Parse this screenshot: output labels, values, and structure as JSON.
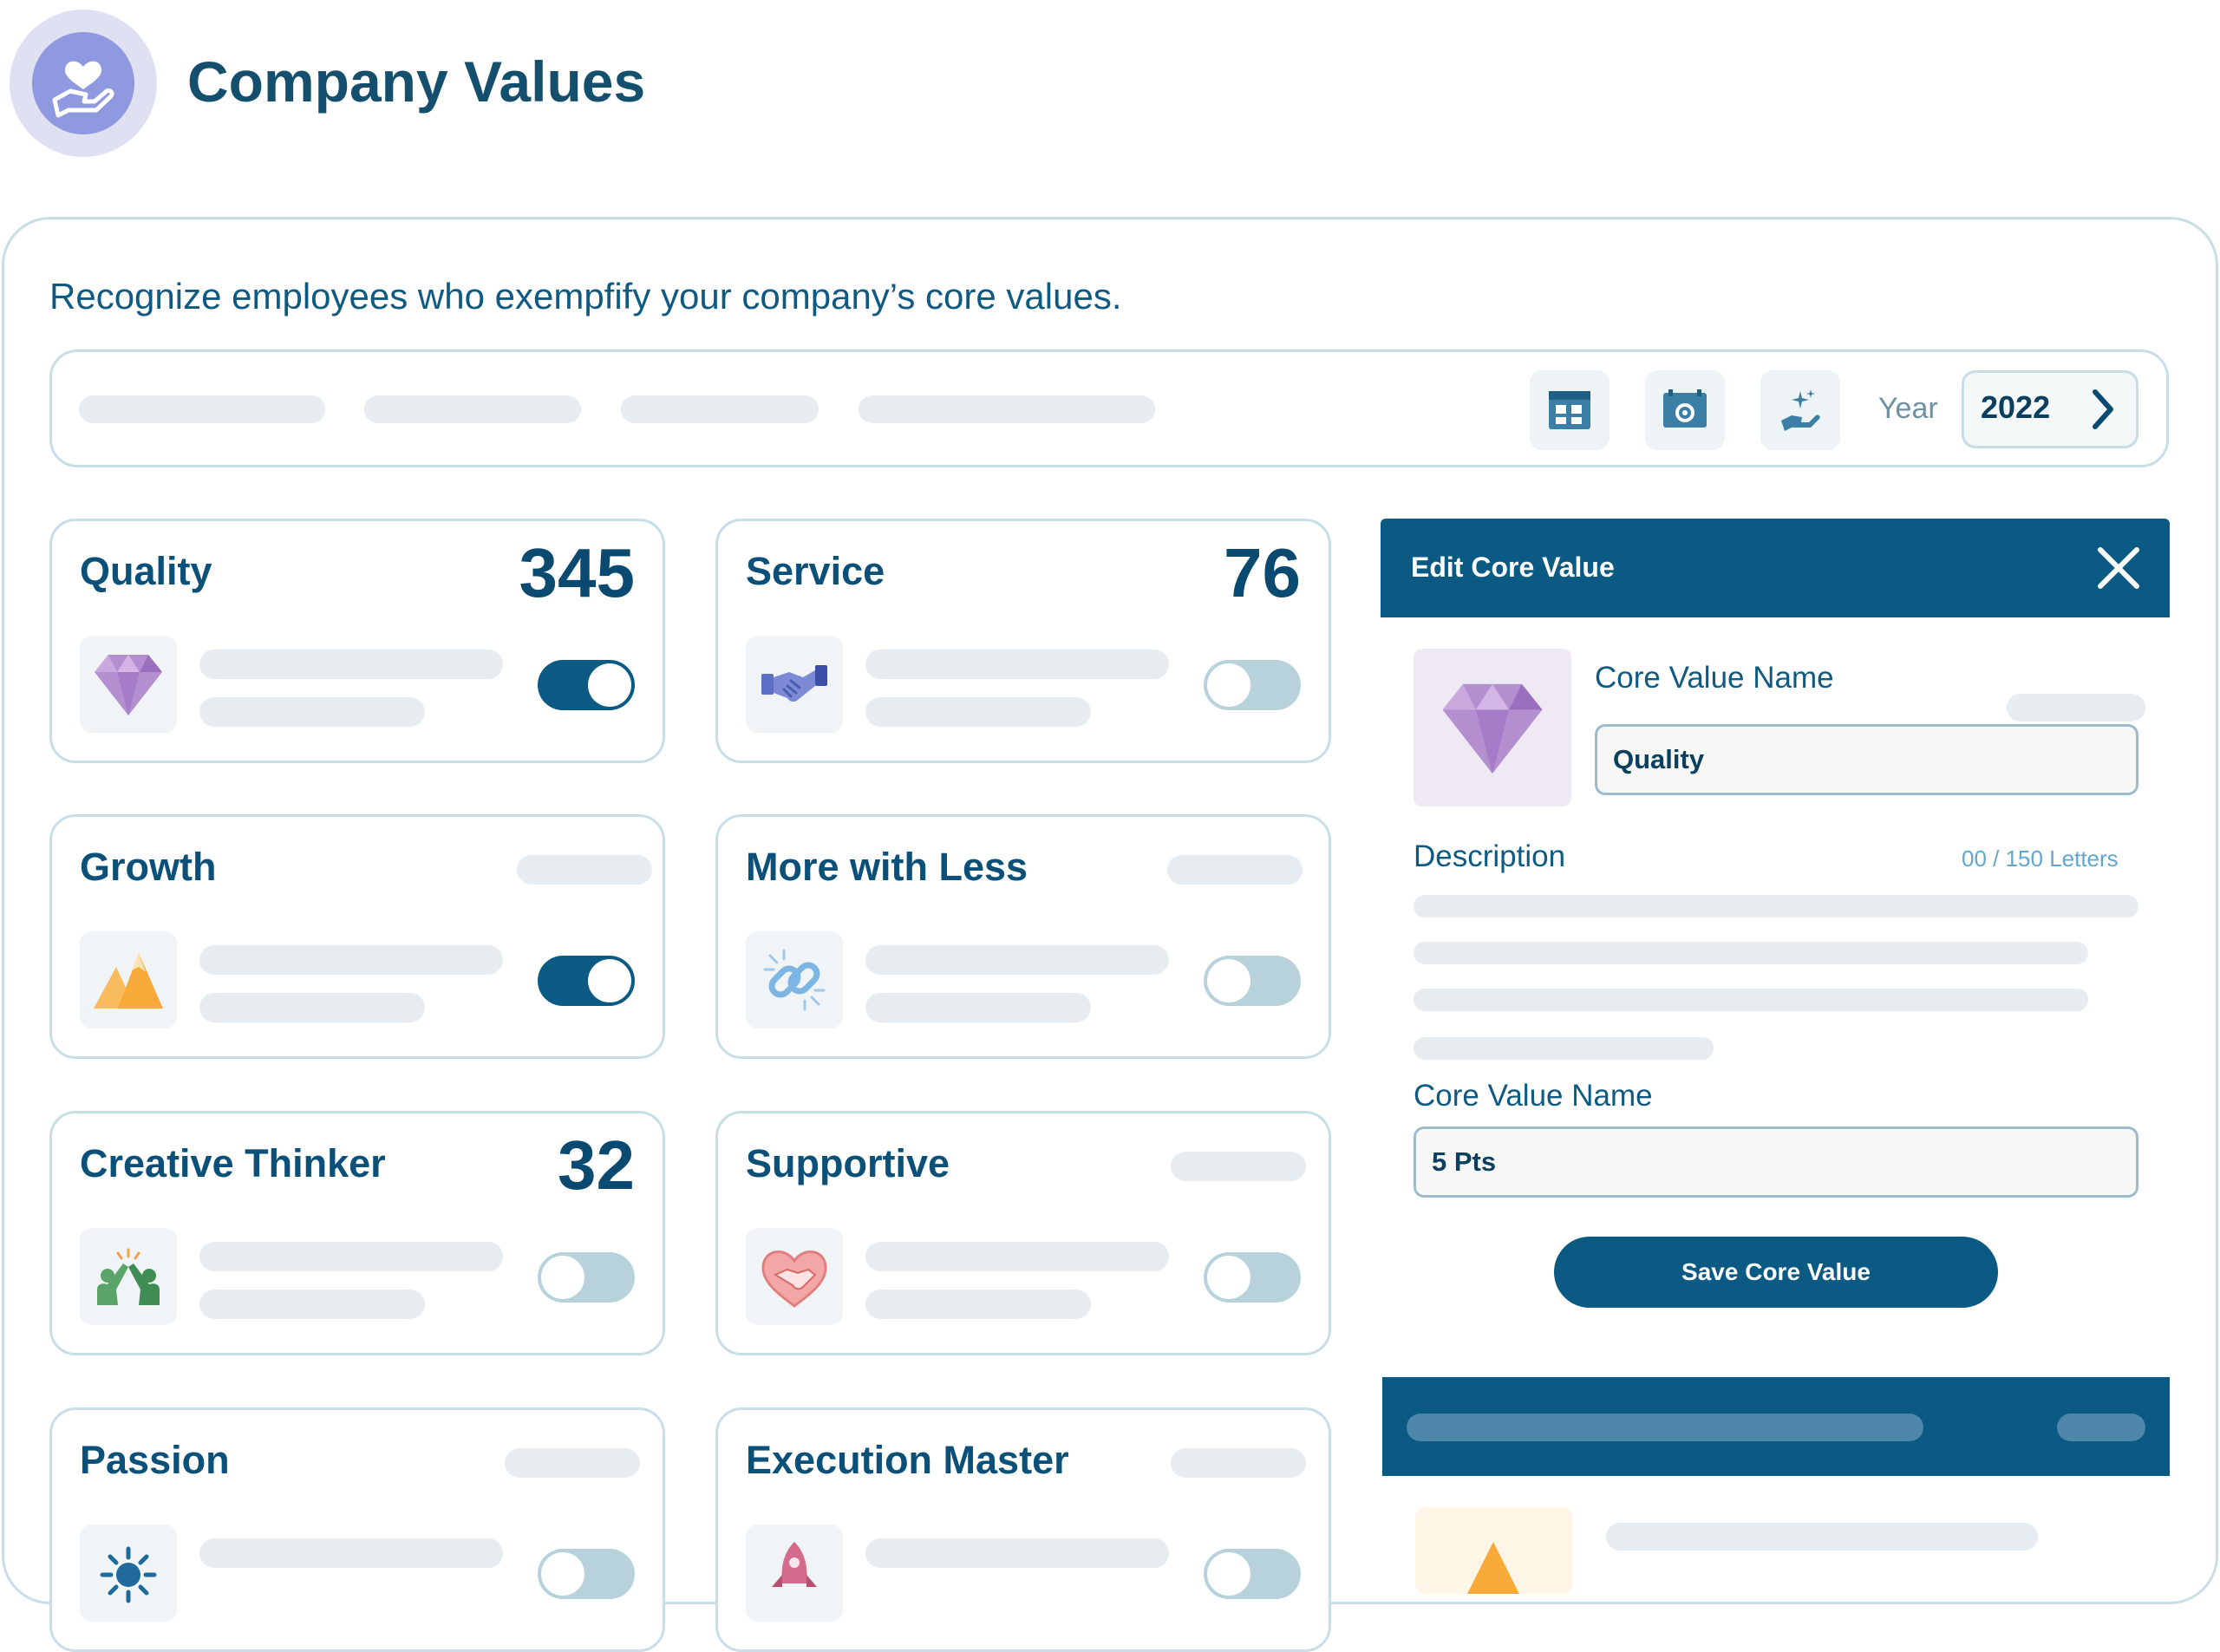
{
  "header": {
    "title": "Company Values",
    "logo_icon": "heart-in-hand-icon"
  },
  "main": {
    "subtitle": "Recognize employees who exempfify your company’s core values."
  },
  "toolbar": {
    "icons": [
      "calendar-grid-icon",
      "calendar-settings-icon",
      "sparkle-hand-icon"
    ],
    "year_label": "Year",
    "year_value": "2022",
    "next_icon": "chevron-right-icon"
  },
  "cards": [
    {
      "title": "Quality",
      "count": "345",
      "icon": "diamond-icon",
      "enabled": true
    },
    {
      "title": "Service",
      "count": "76",
      "icon": "handshake-icon",
      "enabled": false
    },
    {
      "title": "Growth",
      "count": "",
      "icon": "mountain-icon",
      "enabled": true
    },
    {
      "title": "More with Less",
      "count": "",
      "icon": "chain-link-icon",
      "enabled": false
    },
    {
      "title": "Creative Thinker",
      "count": "32",
      "icon": "high-five-icon",
      "enabled": false
    },
    {
      "title": "Supportive",
      "count": "",
      "icon": "heart-handshake-icon",
      "enabled": false
    },
    {
      "title": "Passion",
      "count": "",
      "icon": "sun-icon",
      "enabled": false
    },
    {
      "title": "Execution Master",
      "count": "",
      "icon": "rocket-icon",
      "enabled": false
    }
  ],
  "edit_panel": {
    "title": "Edit Core Value",
    "close_icon": "close-icon",
    "name_label": "Core Value Name",
    "name_value": "Quality",
    "description_label": "Description",
    "char_counter": "00 / 150 Letters",
    "points_label": "Core Value Name",
    "points_value": "5 Pts",
    "save_label": "Save Core Value"
  },
  "colors": {
    "primary": "#0b5a84",
    "title": "#144f6e",
    "border": "#c8dde5",
    "skeleton": "#e6ecf0",
    "toggle_off": "#b8d2dc"
  }
}
